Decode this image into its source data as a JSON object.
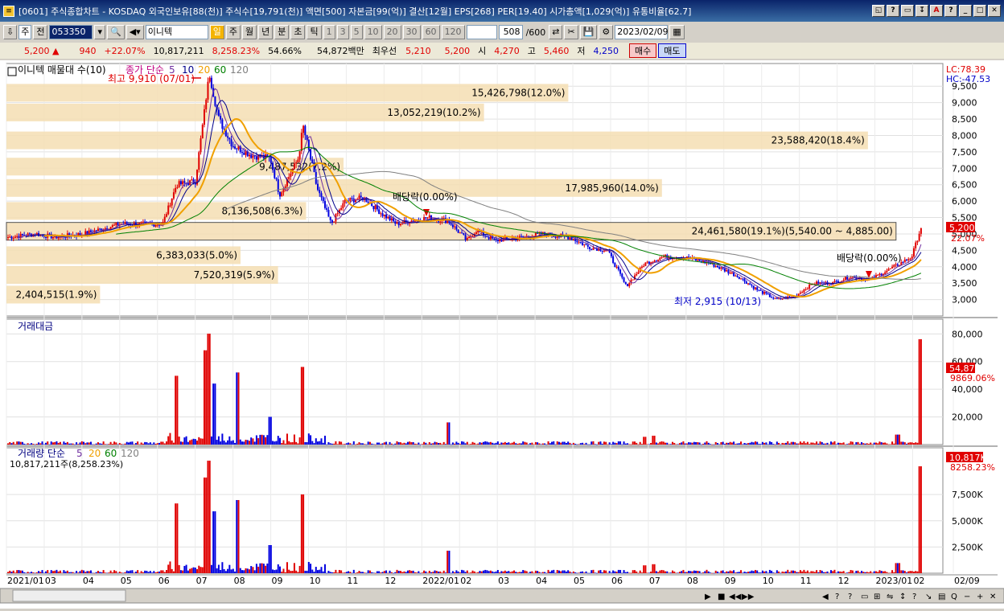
{
  "titlebar": {
    "app_icon": "chart-app-icon",
    "text": "[0601] 주식종합차트 - KOSDAQ 외국인보유[88(천)] 주식수[19,791(천)] 액면[500] 자본금[99(억)] 결산[12월] EPS[268] PER[19.40] 시가총액[1,029(억)] 유통비율[62.7]",
    "buttons": [
      "◱",
      "?",
      "▭",
      "↧",
      "A",
      "?",
      "_",
      "□",
      "✕"
    ]
  },
  "toolbar": {
    "type": "주",
    "prefix": "전",
    "code": "053350",
    "name": "이니텍",
    "period": "일",
    "periods": [
      "주",
      "월",
      "년",
      "분",
      "초",
      "틱"
    ],
    "nums": [
      "1",
      "3",
      "5",
      "10",
      "20",
      "30",
      "60",
      "120"
    ],
    "count": "508",
    "total": "/600",
    "date": "2023/02/09"
  },
  "infobar": {
    "price": "5,200",
    "arrow": "▲",
    "change": "940",
    "change_pct": "+22.07%",
    "volume": "10,817,211",
    "vol_pct": "8,258.23%",
    "ratio": "54.66%",
    "amount": "54,872백만",
    "best_label": "최우선",
    "best_ask": "5,210",
    "best_bid": "5,200",
    "open_label": "시",
    "open": "4,270",
    "high_label": "고",
    "high": "5,460",
    "low_label": "저",
    "low": "4,250",
    "buy": "매수",
    "sell": "매도"
  },
  "panes": {
    "price_title": "이니텍 매물대 수(10)",
    "ma_label": "종가 단순",
    "ma_periods": [
      "5",
      "10",
      "20",
      "60",
      "120"
    ],
    "amount_title": "거래대금",
    "volume_title": "거래량 단순",
    "volume_ma": [
      "5",
      "20",
      "60",
      "120"
    ],
    "volume_value": "10,817,211주(8,258.23%)"
  },
  "right_labels": {
    "lc": "LC:78.39",
    "hc": "HC:-47.53",
    "price_now": "5,200",
    "price_pct": "22.07%",
    "amount_now": "54,872",
    "amount_pct": "9869.06%",
    "vol_now": "10,817K",
    "vol_pct": "8258.23%"
  },
  "chart_data": {
    "type": "candlestick",
    "price_axis": {
      "min": 2500,
      "max": 9800,
      "ticks": [
        "3,000",
        "3,500",
        "4,000",
        "4,500",
        "5,000",
        "5,500",
        "6,000",
        "6,500",
        "7,000",
        "7,500",
        "8,000",
        "8,500",
        "9,000",
        "9,500"
      ]
    },
    "amount_axis": {
      "ticks": [
        "20,000",
        "40,000",
        "60,000",
        "80,000"
      ]
    },
    "volume_axis": {
      "ticks": [
        "2,500K",
        "5,000K",
        "7,500K"
      ]
    },
    "x_labels": [
      "2021/01",
      "03",
      "04",
      "05",
      "06",
      "07",
      "08",
      "09",
      "10",
      "11",
      "12",
      "2022/01",
      "02",
      "03",
      "04",
      "05",
      "06",
      "07",
      "08",
      "09",
      "10",
      "11",
      "12",
      "2023/01",
      "02",
      "02/09"
    ],
    "close_keypoints": [
      [
        0,
        4900
      ],
      [
        0.03,
        5000
      ],
      [
        0.05,
        4900
      ],
      [
        0.08,
        5000
      ],
      [
        0.1,
        5150
      ],
      [
        0.12,
        5300
      ],
      [
        0.14,
        5300
      ],
      [
        0.165,
        5300
      ],
      [
        0.18,
        6500
      ],
      [
        0.2,
        6600
      ],
      [
        0.215,
        9910
      ],
      [
        0.225,
        8500
      ],
      [
        0.24,
        7700
      ],
      [
        0.26,
        7400
      ],
      [
        0.28,
        7300
      ],
      [
        0.29,
        6200
      ],
      [
        0.31,
        7300
      ],
      [
        0.315,
        8300
      ],
      [
        0.33,
        6400
      ],
      [
        0.345,
        5300
      ],
      [
        0.36,
        6000
      ],
      [
        0.38,
        6100
      ],
      [
        0.4,
        5600
      ],
      [
        0.415,
        5300
      ],
      [
        0.43,
        5400
      ],
      [
        0.45,
        5500
      ],
      [
        0.47,
        5400
      ],
      [
        0.49,
        4800
      ],
      [
        0.5,
        5100
      ],
      [
        0.52,
        4800
      ],
      [
        0.55,
        4900
      ],
      [
        0.57,
        5000
      ],
      [
        0.6,
        4900
      ],
      [
        0.62,
        4600
      ],
      [
        0.64,
        4500
      ],
      [
        0.66,
        3400
      ],
      [
        0.68,
        4100
      ],
      [
        0.7,
        4300
      ],
      [
        0.72,
        4300
      ],
      [
        0.75,
        4100
      ],
      [
        0.78,
        3700
      ],
      [
        0.8,
        3300
      ],
      [
        0.82,
        3000
      ],
      [
        0.84,
        3100
      ],
      [
        0.86,
        3500
      ],
      [
        0.88,
        3500
      ],
      [
        0.9,
        3700
      ],
      [
        0.92,
        3600
      ],
      [
        0.94,
        3900
      ],
      [
        0.965,
        4300
      ],
      [
        0.975,
        5200
      ]
    ],
    "annotations": {
      "high": "최고 9,910 (07/01)",
      "low": "최저 2,915 (10/13)",
      "div1": "배당락(0.00%)",
      "div2": "배당락(0.00%)"
    },
    "volume_profile": [
      {
        "price": 9300,
        "label": "15,426,798(12.0%)",
        "width": 0.6
      },
      {
        "price": 8700,
        "label": "13,052,219(10.2%)",
        "width": 0.51
      },
      {
        "price": 7850,
        "label": "23,588,420(18.4%)",
        "width": 0.92
      },
      {
        "price": 7050,
        "label": "9,487,532(7.2%)",
        "width": 0.36
      },
      {
        "price": 6400,
        "label": "17,985,960(14.0%)",
        "width": 0.7
      },
      {
        "price": 5700,
        "label": "8,136,508(6.3%)",
        "width": 0.32
      },
      {
        "price": 5080,
        "label": "24,461,580(19.1%)(5,540.00 ~ 4,885.00)",
        "width": 0.95
      },
      {
        "price": 4350,
        "label": "6,383,033(5.0%)",
        "width": 0.25
      },
      {
        "price": 3750,
        "label": "7,520,319(5.9%)",
        "width": 0.29
      },
      {
        "price": 3150,
        "label": "2,404,515(1.9%)",
        "width": 0.1
      }
    ],
    "spikes": [
      [
        0.18,
        0.62
      ],
      [
        0.21,
        0.85
      ],
      [
        0.215,
        1.0
      ],
      [
        0.22,
        0.55
      ],
      [
        0.245,
        0.65
      ],
      [
        0.315,
        0.7
      ],
      [
        0.28,
        0.25
      ],
      [
        0.47,
        0.2
      ],
      [
        0.68,
        0.07
      ],
      [
        0.69,
        0.08
      ],
      [
        0.95,
        0.09
      ],
      [
        0.975,
        0.95
      ]
    ],
    "colors": {
      "up": "#e00000",
      "down": "#0000e0",
      "ma5": "#7030a0",
      "ma10": "#00008b",
      "ma20": "#f0a000",
      "ma60": "#008000",
      "ma120": "#808080",
      "profile": "#f5deb3"
    }
  }
}
